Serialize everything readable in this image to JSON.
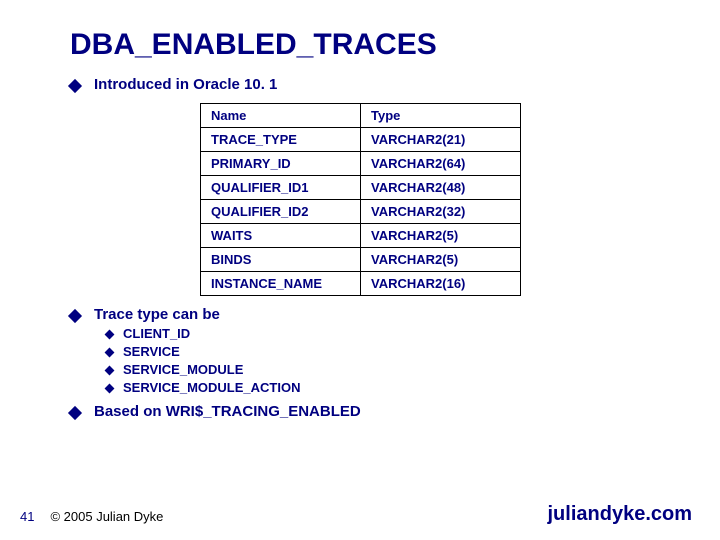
{
  "title": "DBA_ENABLED_TRACES",
  "bullet1": "Introduced in Oracle 10. 1",
  "table": {
    "headers": {
      "name": "Name",
      "type": "Type"
    },
    "rows": [
      {
        "name": "TRACE_TYPE",
        "type": "VARCHAR2(21)"
      },
      {
        "name": "PRIMARY_ID",
        "type": "VARCHAR2(64)"
      },
      {
        "name": "QUALIFIER_ID1",
        "type": "VARCHAR2(48)"
      },
      {
        "name": "QUALIFIER_ID2",
        "type": "VARCHAR2(32)"
      },
      {
        "name": "WAITS",
        "type": "VARCHAR2(5)"
      },
      {
        "name": "BINDS",
        "type": "VARCHAR2(5)"
      },
      {
        "name": "INSTANCE_NAME",
        "type": "VARCHAR2(16)"
      }
    ]
  },
  "bullet2": "Trace type can be",
  "trace_types": [
    "CLIENT_ID",
    "SERVICE",
    "SERVICE_MODULE",
    "SERVICE_MODULE_ACTION"
  ],
  "bullet3_prefix": "Based on ",
  "bullet3_strong": "WRI$_TRACING_ENABLED",
  "page_number": "41",
  "copyright": "© 2005 Julian Dyke",
  "site": "juliandyke.com"
}
